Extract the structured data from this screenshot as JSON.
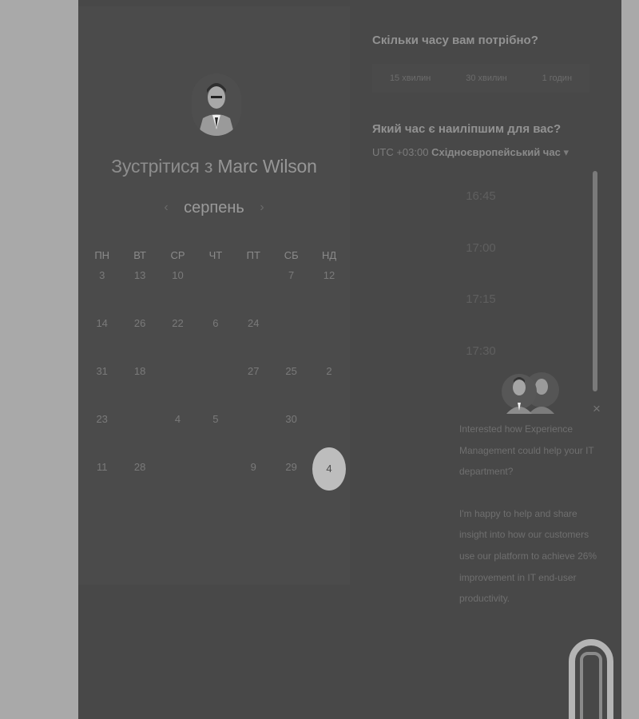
{
  "booking": {
    "title_prefix": "Зустрітися з",
    "host_name": "Marc Wilson",
    "calendar": {
      "month": "серпень",
      "prev_arrow": "‹",
      "next_arrow": "›",
      "weekdays": [
        "ПН",
        "ВТ",
        "СР",
        "ЧТ",
        "ПТ",
        "СБ",
        "НД"
      ],
      "rows": [
        [
          "3",
          "13",
          "10",
          "",
          "",
          "7",
          "12"
        ],
        [
          "14",
          "26",
          "22",
          "6",
          "24",
          "",
          ""
        ],
        [
          "31",
          "18",
          "",
          "",
          "27",
          "25",
          "2"
        ],
        [
          "23",
          "",
          "4",
          "5",
          "",
          "30",
          ""
        ],
        [
          "11",
          "28",
          "",
          "",
          "9",
          "29",
          "4"
        ]
      ],
      "selected_day": "4"
    }
  },
  "duration": {
    "question": "Скільки часу вам потрібно?",
    "options": [
      "15 хвилин",
      "30 хвилин",
      "1 годин"
    ]
  },
  "time": {
    "question": "Який час є наиліпшим для вас?",
    "timezone_offset": "UTC +03:00",
    "timezone_name": "Східноєвропейський час",
    "dropdown_caret": "▾",
    "slots": [
      "16:45",
      "17:00",
      "17:15",
      "17:30"
    ]
  },
  "chat": {
    "close_label": "×",
    "message_1": "Interested how Experience Management could help your IT department?",
    "message_2": "I'm happy to help and share insight into how our customers use our platform to achieve 26% improvement in IT end-user productivity."
  }
}
